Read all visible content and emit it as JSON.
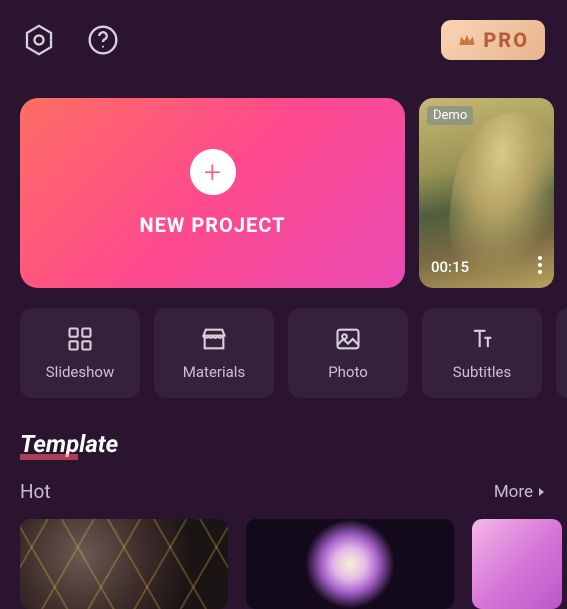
{
  "header": {
    "pro_label": "PRO"
  },
  "main": {
    "new_project_label": "NEW PROJECT",
    "demo": {
      "badge": "Demo",
      "duration": "00:15"
    }
  },
  "tools": [
    {
      "label": "Slideshow"
    },
    {
      "label": "Materials"
    },
    {
      "label": "Photo"
    },
    {
      "label": "Subtitles"
    }
  ],
  "template": {
    "title": "Template",
    "tab": "Hot",
    "more": "More"
  }
}
